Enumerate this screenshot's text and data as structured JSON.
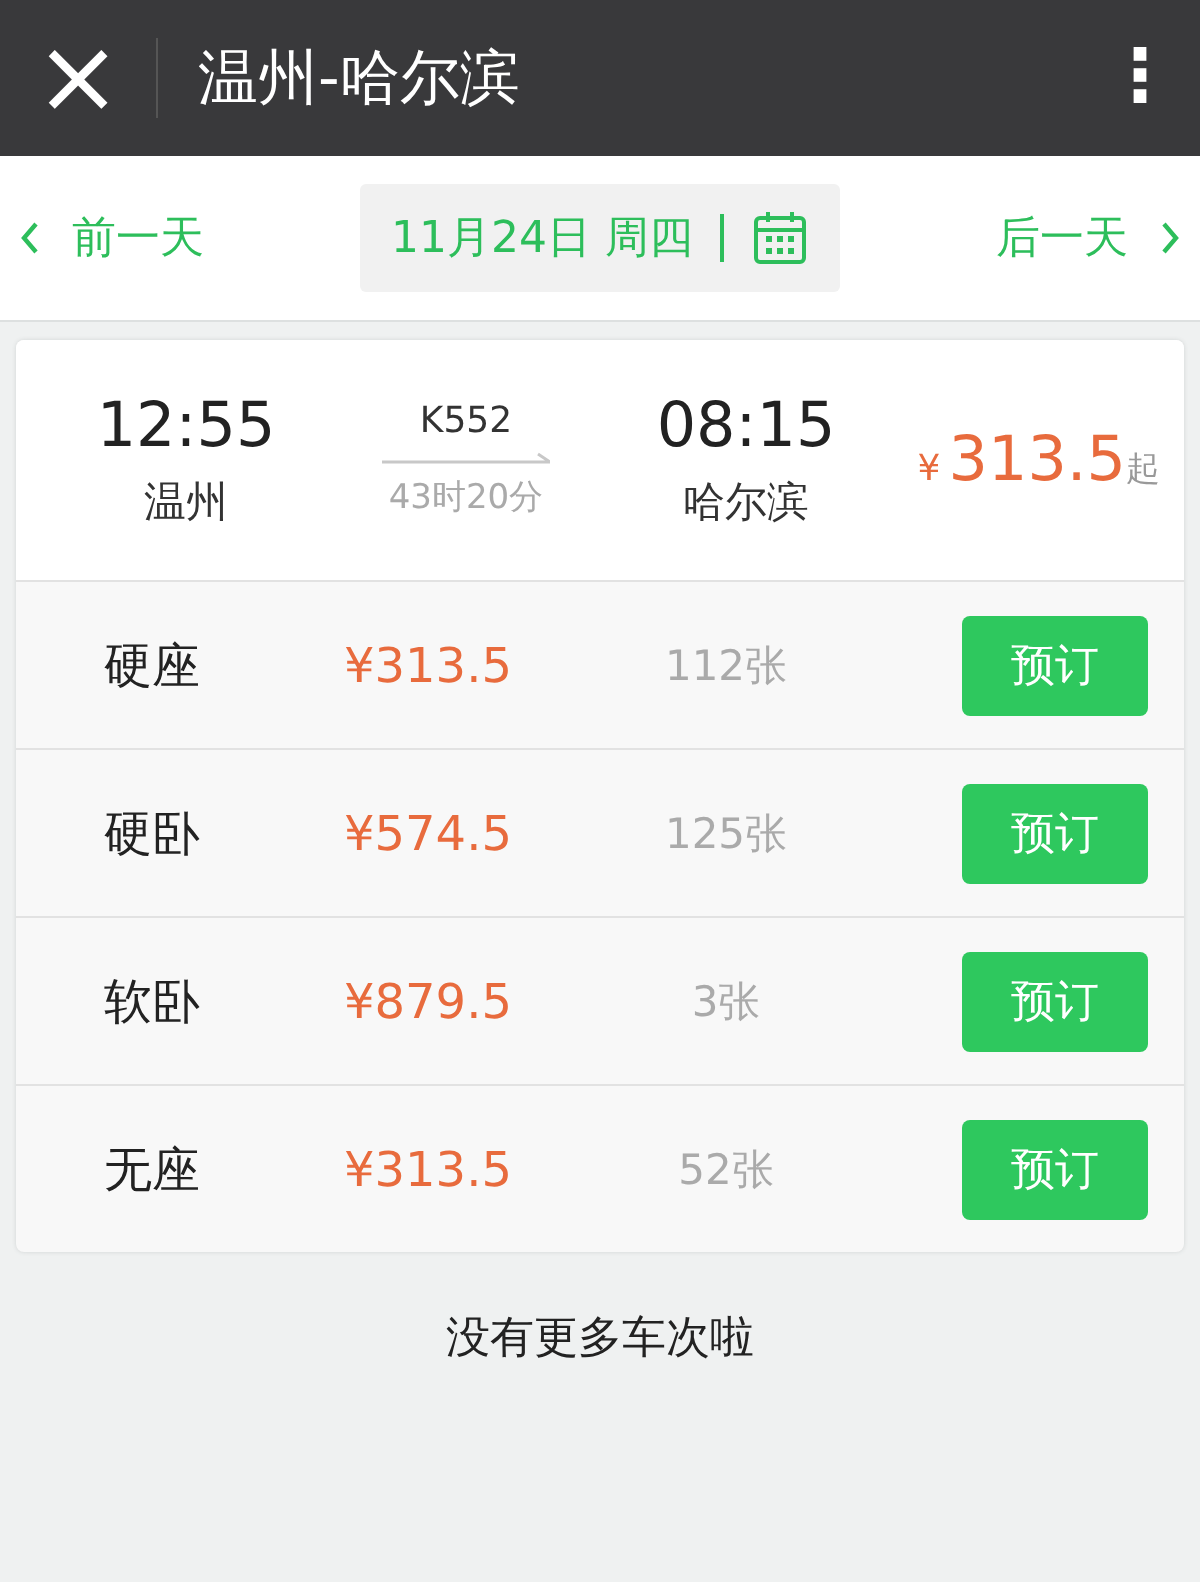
{
  "header": {
    "close": "×",
    "title": "温州-哈尔滨",
    "menu": "⋮"
  },
  "date_bar": {
    "prev": "前一天",
    "date": "11月24日 周四",
    "next": "后一天"
  },
  "train": {
    "depart_time": "12:55",
    "depart_station": "温州",
    "number": "K552",
    "duration": "43时20分",
    "arrive_time": "08:15",
    "arrive_station": "哈尔滨",
    "price_currency": "¥",
    "price": "313.5",
    "price_suffix": "起"
  },
  "seats": [
    {
      "type": "硬座",
      "price": "¥313.5",
      "tickets": "112张",
      "button": "预订"
    },
    {
      "type": "硬卧",
      "price": "¥574.5",
      "tickets": "125张",
      "button": "预订"
    },
    {
      "type": "软卧",
      "price": "¥879.5",
      "tickets": "3张",
      "button": "预订"
    },
    {
      "type": "无座",
      "price": "¥313.5",
      "tickets": "52张",
      "button": "预订"
    }
  ],
  "footer": "没有更多车次啦"
}
